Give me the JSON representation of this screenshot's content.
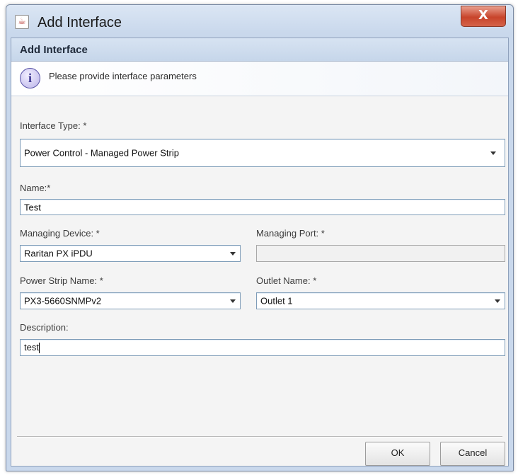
{
  "window": {
    "title": "Add Interface",
    "close_glyph": "X",
    "app_icon": "java-cup-icon"
  },
  "header": {
    "title": "Add Interface"
  },
  "info": {
    "icon": "info-icon",
    "glyph": "i",
    "message": "Please provide interface parameters"
  },
  "form": {
    "interface_type": {
      "label": "Interface Type: *",
      "value": "Power Control - Managed Power Strip"
    },
    "name": {
      "label": "Name:*",
      "value": "Test"
    },
    "managing_device": {
      "label": "Managing Device: *",
      "value": "Raritan PX iPDU"
    },
    "managing_port": {
      "label": "Managing Port: *",
      "value": ""
    },
    "power_strip_name": {
      "label": "Power Strip Name: *",
      "value": "PX3-5660SNMPv2"
    },
    "outlet_name": {
      "label": "Outlet Name: *",
      "value": "Outlet 1"
    },
    "description": {
      "label": "Description:",
      "value": "test"
    }
  },
  "buttons": {
    "ok": "OK",
    "cancel": "Cancel"
  },
  "colors": {
    "close_button": "#c8442b",
    "field_border": "#7f9db9",
    "header_bg": "#c6d6ea"
  }
}
